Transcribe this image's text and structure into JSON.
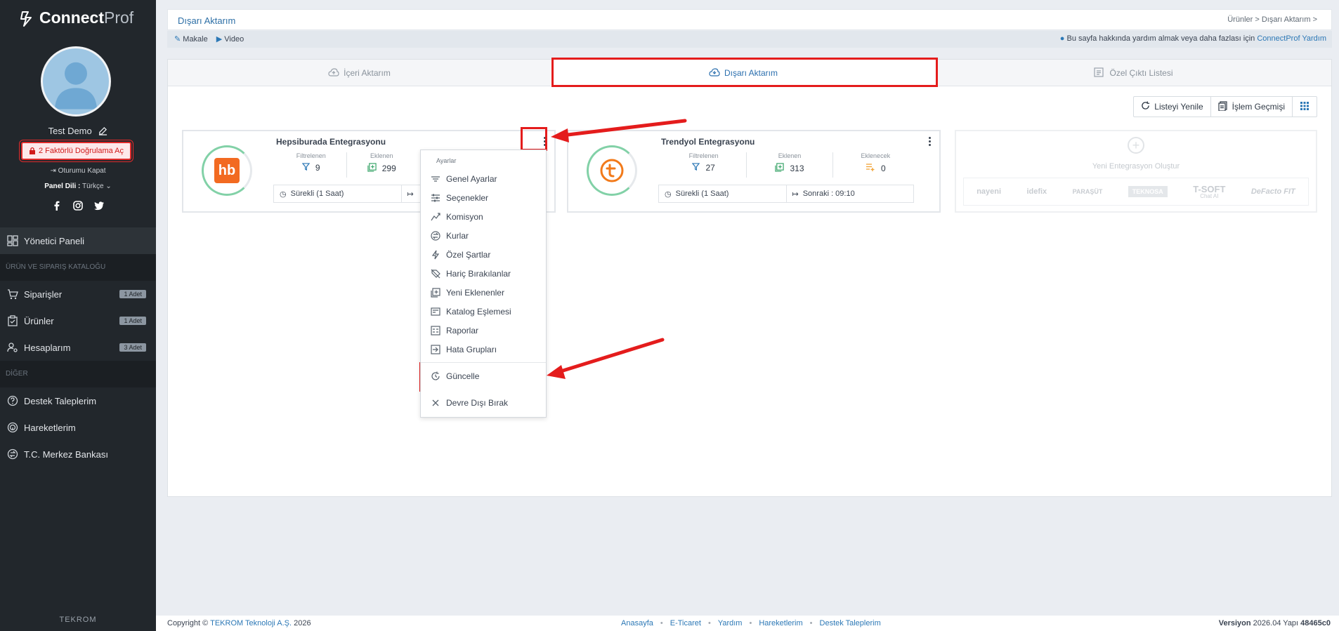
{
  "app": {
    "brand_bold": "Connect",
    "brand_light": "Prof"
  },
  "user": {
    "name": "Test Demo",
    "tfa_label": "2 Faktörlü Doğrulama Aç",
    "logout_label": "Oturumu Kapat",
    "lang_label": "Panel Dili :",
    "lang_value": "Türkçe"
  },
  "sidebar": {
    "items": [
      {
        "label": "Yönetici Paneli"
      },
      {
        "label": "ÜRÜN VE SIPARIŞ KATALOĞU"
      },
      {
        "label": "Siparişler",
        "badge": "1 Adet"
      },
      {
        "label": "Ürünler",
        "badge": "1 Adet"
      },
      {
        "label": "Hesaplarım",
        "badge": "3 Adet"
      },
      {
        "label": "DİĞER"
      },
      {
        "label": "Destek Taleplerim"
      },
      {
        "label": "Hareketlerim"
      },
      {
        "label": "T.C. Merkez Bankası"
      }
    ],
    "footer": "TEKROM"
  },
  "header": {
    "title": "Dışarı Aktarım",
    "breadcrumb": "Ürünler  >   Dışarı Aktarım  >",
    "links": [
      "Makale",
      "Video"
    ],
    "help_text": "Bu sayfa hakkında yardım almak veya daha fazlası için",
    "help_link": "ConnectProf Yardım"
  },
  "tabs": [
    "İçeri Aktarım",
    "Dışarı Aktarım",
    "Özel Çıktı Listesi"
  ],
  "toolbar": {
    "refresh": "Listeyi Yenile",
    "history": "İşlem Geçmişi"
  },
  "cards": [
    {
      "name": "Hepsiburada Entegrasyonu",
      "logo_text": "hb",
      "logo_color": "#f26a21",
      "stat_labels": [
        "Filtrelenen",
        "Eklenen"
      ],
      "stat_values": [
        "9",
        "299"
      ],
      "schedule": "Sürekli (1 Saat)",
      "next": ""
    },
    {
      "name": "Trendyol Entegrasyonu",
      "logo_color": "#f27a1a",
      "stat_labels": [
        "Filtrelenen",
        "Eklenen",
        "Eklenecek"
      ],
      "stat_values": [
        "27",
        "313",
        "0"
      ],
      "schedule": "Sürekli (1 Saat)",
      "next": "Sonraki : 09:10"
    }
  ],
  "new_integration": {
    "label": "Yeni Entegrasyon Oluştur",
    "brands": [
      "nayeni",
      "idefix",
      "PARAŞÜT",
      "TEKNOSA",
      "T-SOFT",
      "DeFacto FIT"
    ],
    "brand_sub": "Chat AI"
  },
  "dropdown": {
    "heading": "Ayarlar",
    "items": [
      "Genel Ayarlar",
      "Seçenekler",
      "Komisyon",
      "Kurlar",
      "Özel Şartlar",
      "Hariç Bırakılanlar",
      "Yeni Eklenenler",
      "Katalog Eşlemesi",
      "Raporlar",
      "Hata Grupları",
      "Güncelle",
      "Devre Dışı Bırak"
    ]
  },
  "footer": {
    "copy_prefix": "Copyright ©",
    "company": "TEKROM Teknoloji A.Ş.",
    "year": "2026",
    "nav": [
      "Anasayfa",
      "E-Ticaret",
      "Yardım",
      "Hareketlerim",
      "Destek Taleplerim"
    ],
    "version_label": "Versiyon",
    "version": "2026.04",
    "build_label": "Yapı",
    "build": "48465c0"
  },
  "colors": {
    "accent": "#2c78b6",
    "highlight": "#e41c1c",
    "sidebar": "#22272c"
  }
}
